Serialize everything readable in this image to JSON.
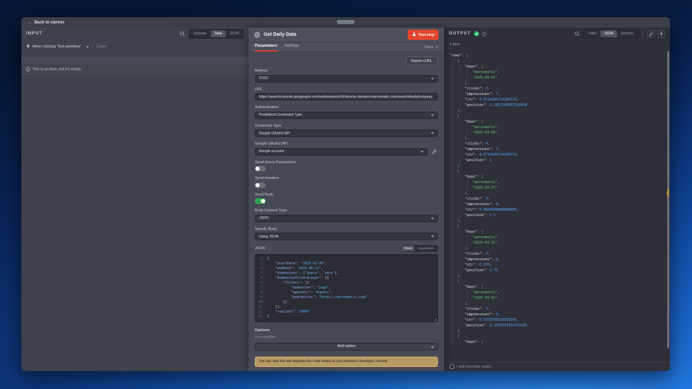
{
  "colors": {
    "accent_red": "#e2472e",
    "toggle_on": "#2fa84f",
    "success_green": "#2fbf71",
    "notice_bg": "#b79b63",
    "brace_orange": "#f5a623"
  },
  "icons": {
    "back_arrow": "←",
    "external_link": "↗",
    "brace": "{"
  },
  "topbar": {
    "back_label": "Back to canvas"
  },
  "input_panel": {
    "title": "INPUT",
    "views": [
      "Schema",
      "Table",
      "JSON"
    ],
    "active_view": "Table",
    "source_label": "When clicking 'Test workflow'",
    "source_count": "1 item",
    "empty_message": "This is an item, but it's empty."
  },
  "node_panel": {
    "title": "Get Daily Data",
    "test_button_label": "Test step",
    "tabs": [
      "Parameters",
      "Settings"
    ],
    "active_tab": "Parameters",
    "docs_label": "Docs",
    "import_curl_label": "Import cURL",
    "fields": {
      "method": {
        "label": "Method",
        "value": "POST"
      },
      "url": {
        "label": "URL",
        "value": "https://searchconsole.googleapis.com/webmasters/v3/sites/sc-domain:marvomatic.com/searchAnalytics/query"
      },
      "authentication": {
        "label": "Authentication",
        "value": "Predefined Credential Type"
      },
      "credential_type": {
        "label": "Credential Type",
        "value": "Google OAuth2 API"
      },
      "google_oauth2": {
        "label": "Google OAuth2 API",
        "value": "Google account"
      },
      "send_query_parameters": {
        "label": "Send Query Parameters",
        "on": false
      },
      "send_headers": {
        "label": "Send Headers",
        "on": false
      },
      "send_body": {
        "label": "Send Body",
        "on": true
      },
      "body_content_type": {
        "label": "Body Content Type",
        "value": "JSON"
      },
      "specify_body": {
        "label": "Specify Body",
        "value": "Using JSON"
      },
      "json_field": {
        "label": "JSON",
        "modes": [
          "Fixed",
          "Expression"
        ],
        "active_mode": "Fixed"
      }
    },
    "json_code": [
      "{",
      "    \"startDate\": \"2025-02-26\",",
      "    \"endDate\": \"2025-06-22\",",
      "    \"dimensions\": [\"query\", \"date\"],",
      "    \"dimensionFilterGroups\": [{",
      "        \"filters\": [{",
      "            \"dimension\": \"page\",",
      "            \"operator\": \"equals\",",
      "            \"expression\": \"https://marvomatic.com/\"",
      "        }]",
      "    }],",
      "    \"rowLimit\": 10000",
      "}"
    ],
    "options": {
      "label": "Options",
      "empty_text": "No properties",
      "add_button_label": "Add option"
    },
    "notice": "You can view the raw requests this node makes in your browser's developer console"
  },
  "output_panel": {
    "title": "OUTPUT",
    "views": [
      "Table",
      "JSON",
      "Schema"
    ],
    "active_view": "JSON",
    "count": "1 item",
    "root_key": "rows",
    "rows": [
      {
        "keys": [
          "marvomatic",
          "2025-04-07"
        ],
        "clicks": 4,
        "impressions": 7,
        "ctr": "0.5714285714285714",
        "position": "1.2857142857142858"
      },
      {
        "keys": [
          "marvomatic",
          "2025-04-09"
        ],
        "clicks": 4,
        "impressions": 7,
        "ctr": "0.5714285714285714",
        "position": "1"
      },
      {
        "keys": [
          "marvomatic",
          "2025-03-27"
        ],
        "clicks": 4,
        "impressions": 6,
        "ctr": "0.6666666666666666",
        "position": "1.5"
      },
      {
        "keys": [
          "marvomatic",
          "2025-03-31"
        ],
        "clicks": 3,
        "impressions": 8,
        "ctr": "0.375",
        "position": "1.75"
      },
      {
        "keys": [
          "marvomatic",
          "2025-04-02"
        ],
        "clicks": 5,
        "impressions": 9,
        "ctr": "0.5555555555555556",
        "position": "2.3333333333333335"
      }
    ],
    "truncated": true,
    "footer": "I wish this node would..."
  }
}
